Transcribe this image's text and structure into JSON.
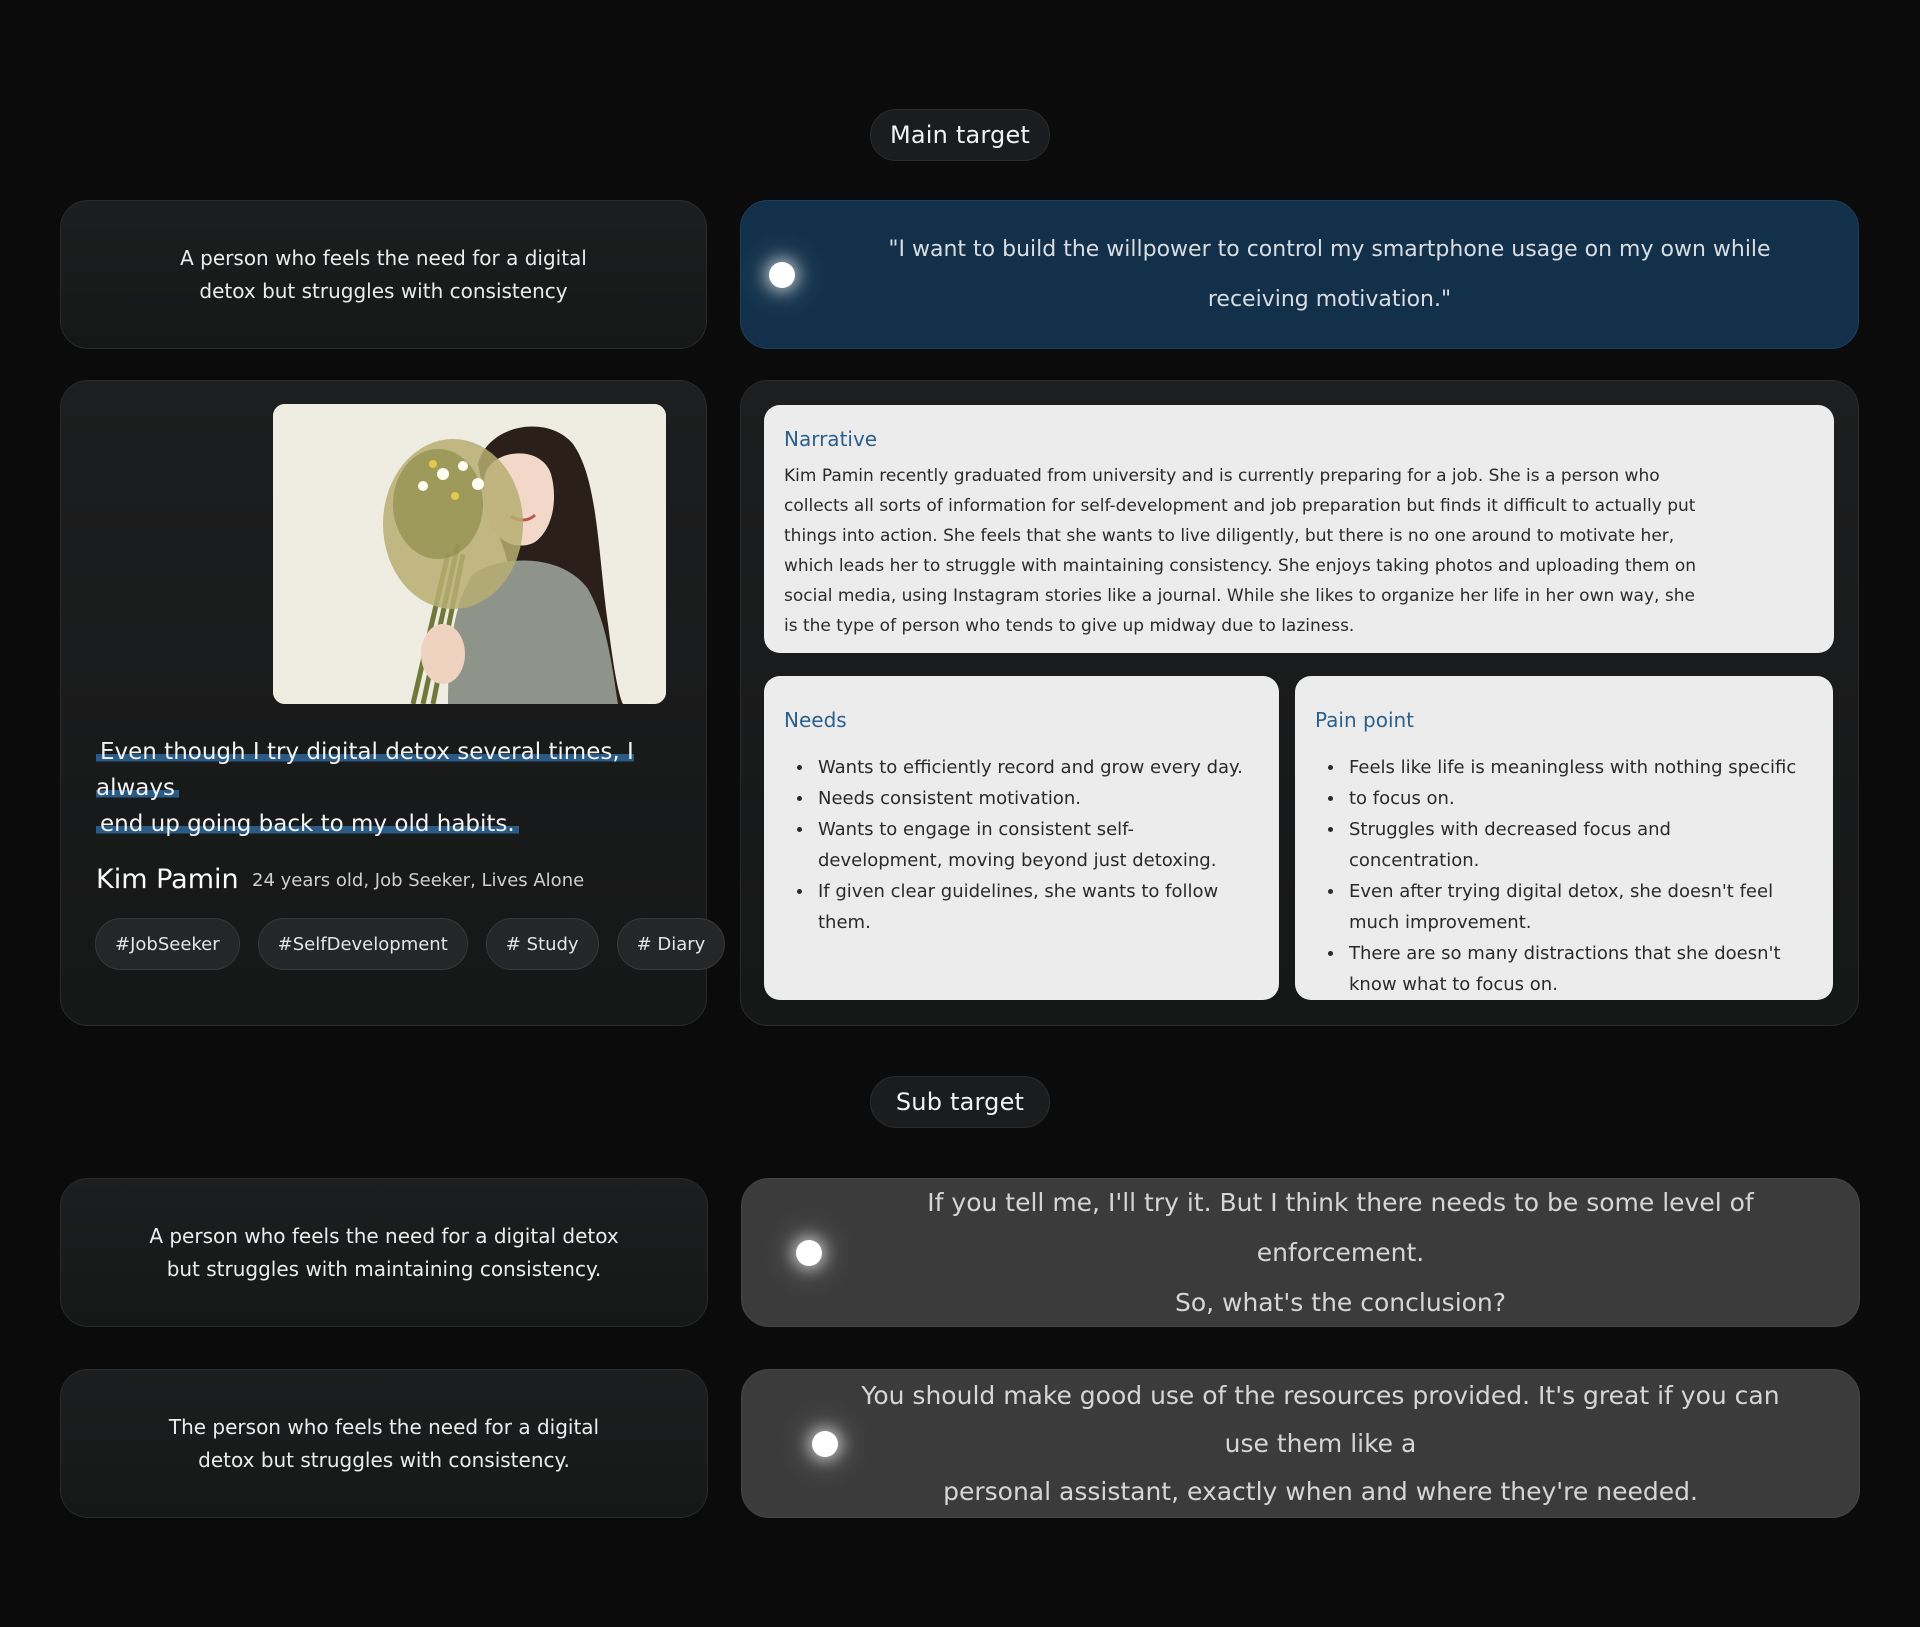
{
  "main_target": {
    "label": "Main target",
    "description": "A person who feels the need for a digital detox but struggles with consistency",
    "quote": "\"I want to build the willpower to control my smartphone usage on my own while  receiving motivation.\""
  },
  "persona": {
    "habit_quote_line1": "Even though I try digital detox several times, I always",
    "habit_quote_line2": "end up going back to my old habits.",
    "name": "Kim Pamin",
    "meta": "24 years old, Job Seeker, Lives Alone",
    "tags": [
      "#JobSeeker",
      "#SelfDevelopment",
      "# Study",
      "# Diary"
    ]
  },
  "narrative": {
    "title": "Narrative",
    "body": "Kim Pamin recently graduated from university and is currently preparing for a job. She is a person who collects all sorts of information for self-development and job preparation but finds it difficult to actually put things into action. She feels that she wants to live diligently, but there is no one around to motivate her, which leads her to struggle with maintaining consistency. She enjoys taking photos and uploading them on social media, using Instagram stories like a journal. While she likes to organize her life in her own way, she is the type of person who tends to give up midway due to laziness."
  },
  "needs": {
    "title": "Needs",
    "items": [
      "Wants to efficiently record and grow every day.",
      "Needs consistent motivation.",
      "Wants to engage in consistent self-development, moving beyond just detoxing.",
      "If given clear guidelines, she wants to follow them."
    ]
  },
  "pain_point": {
    "title": "Pain point",
    "items": [
      "Feels like life is meaningless with nothing specific",
      "to focus on.",
      "Struggles with decreased focus and concentration.",
      "Even after trying digital detox, she doesn't feel much improvement.",
      "There are so many distractions that she doesn't know what to focus on."
    ]
  },
  "sub_target": {
    "label": "Sub target",
    "rows": [
      {
        "description": "A person who feels the need for a digital detox but struggles with maintaining consistency.",
        "quote_line1": "If you tell me, I'll try it. But I think there needs to be some level of enforcement.",
        "quote_line2": "So, what's the conclusion?"
      },
      {
        "description": "The person who feels the need for a digital detox but struggles with consistency.",
        "quote_line1": "You should make good use of the resources provided. It's great if you can use them like a",
        "quote_line2": "personal assistant, exactly when and where they're needed."
      }
    ]
  },
  "colors": {
    "background": "#0b0b0b",
    "accent_blue": "#2b5f8c",
    "quote_card_blue": "#12304a",
    "quote_card_gray": "#3b3b3b",
    "panel": "#ececec"
  },
  "icons": [
    "glow-dot-icon"
  ]
}
